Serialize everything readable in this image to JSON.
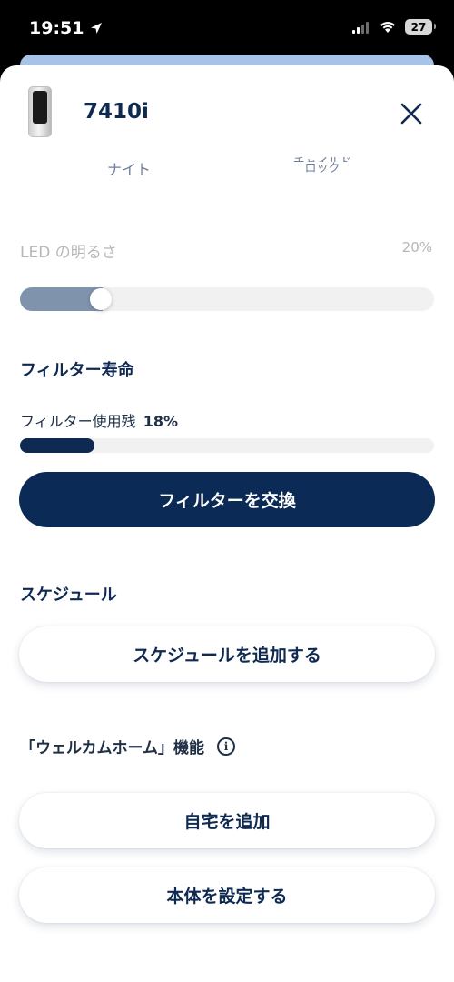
{
  "status_bar": {
    "time": "19:51",
    "battery": "27"
  },
  "header": {
    "device_name": "7410i"
  },
  "mode_tabs": {
    "night": "ナイト",
    "child_lock_line1": "チャイルド",
    "child_lock_line2": "ロック"
  },
  "led": {
    "title": "LED の明るさ",
    "value_label": "20%",
    "level_percent": 20
  },
  "filter": {
    "section_title": "フィルター寿命",
    "remaining_label": "フィルター使用残",
    "remaining_value": "18%",
    "remaining_percent": 18,
    "replace_button": "フィルターを交換"
  },
  "schedule": {
    "section_title": "スケジュール",
    "add_button": "スケジュールを追加する"
  },
  "welcome_home": {
    "section_title": "「ウェルカムホーム」機能",
    "add_home_button": "自宅を追加",
    "setup_device_button": "本体を設定する"
  },
  "colors": {
    "primary": "#0b2a55",
    "slider_fill": "#8093ad",
    "track": "#f1f1f1"
  }
}
